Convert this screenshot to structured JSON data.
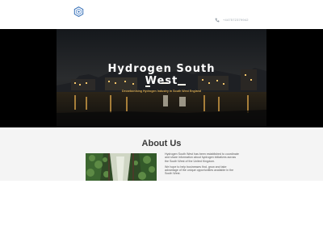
{
  "header": {
    "logo_icon": "hexagon-logo-icon",
    "phone_icon": "phone-icon",
    "phone": "+447572379942"
  },
  "hero": {
    "title_line1": "Hydrogen South",
    "title_line2": "West",
    "subtitle": "Decarbonising Hydrogen Industry in South West England"
  },
  "about": {
    "heading": "About Us",
    "image": "forest-gorge-photo",
    "paragraph1": "Hydrogen South West has been established to coordinate and share information about hydrogen initiatives across the South West of the United Kingdom.",
    "paragraph2": "We hope to help businesses find, grow and take advantage of the unique opportunities available in the South West."
  },
  "colors": {
    "hero_background": "#000000",
    "subtitle_accent": "#d8a84a",
    "section_background": "#f4f4f4",
    "logo_blue": "#3a72b8"
  }
}
